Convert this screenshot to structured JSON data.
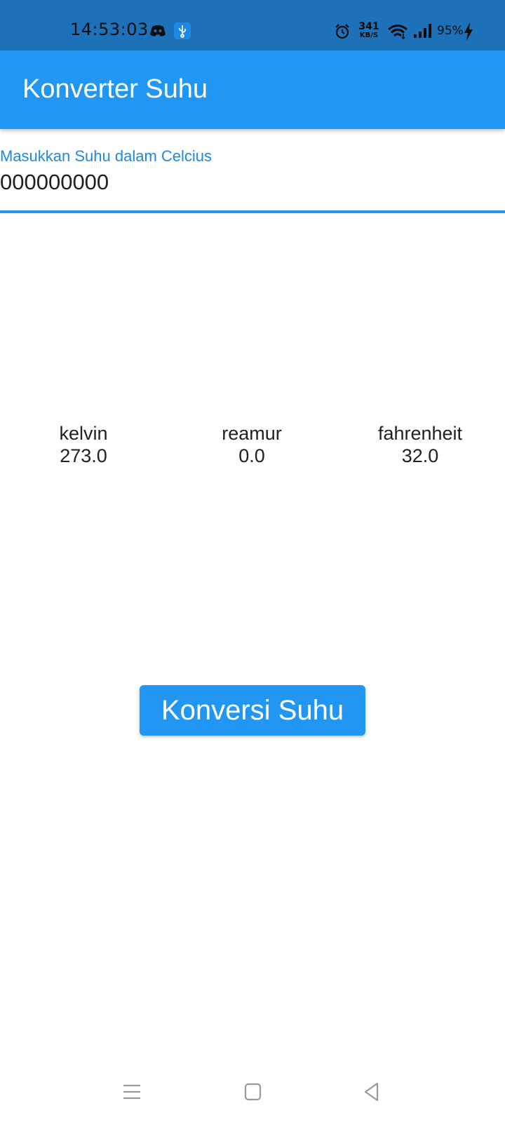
{
  "status_bar": {
    "time": "14:53:03",
    "net_speed": "341",
    "net_speed_unit": "KB/S",
    "battery": "95%",
    "icons": [
      "discord-icon",
      "usb-debug-icon",
      "alarm-icon",
      "wifi-icon",
      "signal-icon",
      "charging-icon"
    ]
  },
  "app_bar": {
    "title": "Konverter Suhu"
  },
  "input": {
    "label": "Masukkan Suhu dalam Celcius",
    "value": "000000000"
  },
  "results": [
    {
      "label": "kelvin",
      "value": "273.0"
    },
    {
      "label": "reamur",
      "value": "0.0"
    },
    {
      "label": "fahrenheit",
      "value": "32.0"
    }
  ],
  "button": {
    "label": "Konversi Suhu"
  },
  "nav": {
    "icons": [
      "menu-icon",
      "home-icon",
      "back-icon"
    ]
  },
  "colors": {
    "status_bar": "#1C71B8",
    "primary": "#2196F3",
    "label_accent": "#1E88E5",
    "text": "#212121"
  }
}
